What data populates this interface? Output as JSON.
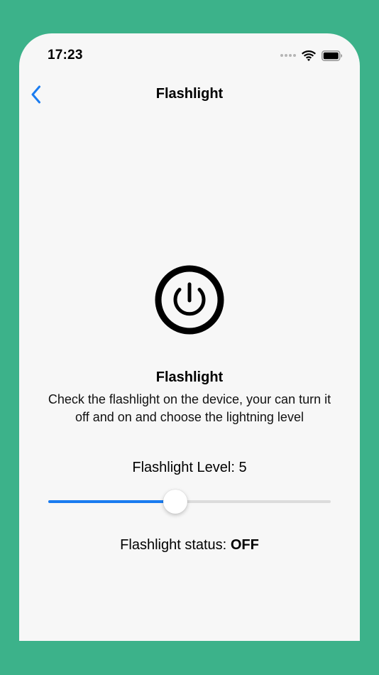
{
  "status_bar": {
    "time": "17:23",
    "icons": [
      "cellular-signal-icon",
      "wifi-icon",
      "battery-icon"
    ]
  },
  "nav": {
    "back_icon": "chevron-left-icon",
    "title": "Flashlight"
  },
  "power": {
    "icon": "power-icon"
  },
  "feature": {
    "title": "Flashlight",
    "description": "Check the flashlight on the device, your can turn it off and on and choose the lightning level"
  },
  "level": {
    "label": "Flashlight Level: 5",
    "value": 5,
    "fraction": 0.45
  },
  "status": {
    "label": "Flashlight status:",
    "value": "OFF"
  },
  "colors": {
    "background": "#3cb28a",
    "screen": "#f7f7f7",
    "accent": "#1a7cf0"
  }
}
